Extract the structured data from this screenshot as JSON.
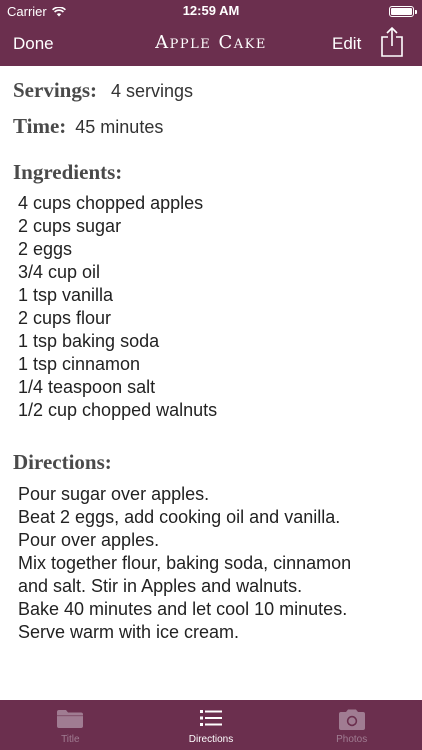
{
  "status_bar": {
    "carrier": "Carrier",
    "time": "12:59 AM"
  },
  "nav": {
    "done_label": "Done",
    "title": "Apple Cake",
    "edit_label": "Edit",
    "share_icon": "share-icon"
  },
  "recipe": {
    "servings_label": "Servings:",
    "servings_value": "4 servings",
    "time_label": "Time:",
    "time_value": "45 minutes",
    "ingredients_heading": "Ingredients:",
    "ingredients": [
      "4 cups chopped apples",
      "2 cups sugar",
      "2 eggs",
      "3/4 cup oil",
      "1 tsp vanilla",
      "2 cups flour",
      "1 tsp baking soda",
      "1 tsp cinnamon",
      "1/4 teaspoon salt",
      "1/2 cup chopped walnuts"
    ],
    "directions_heading": "Directions:",
    "directions": [
      "Pour sugar over apples.",
      "Beat 2 eggs, add cooking oil and vanilla.",
      "Pour over apples.",
      "Mix together flour, baking soda, cinnamon",
      "and salt. Stir in Apples and walnuts.",
      "Bake 40 minutes and let cool 10 minutes.",
      "Serve warm with ice cream."
    ]
  },
  "tabs": [
    {
      "label": "Title",
      "icon": "folder-icon",
      "active": false
    },
    {
      "label": "Directions",
      "icon": "list-icon",
      "active": true
    },
    {
      "label": "Photos",
      "icon": "camera-icon",
      "active": false
    }
  ],
  "colors": {
    "bar_background": "#6b2f4e",
    "active_tab": "#ffffff",
    "inactive_tab": "#a07c92"
  }
}
